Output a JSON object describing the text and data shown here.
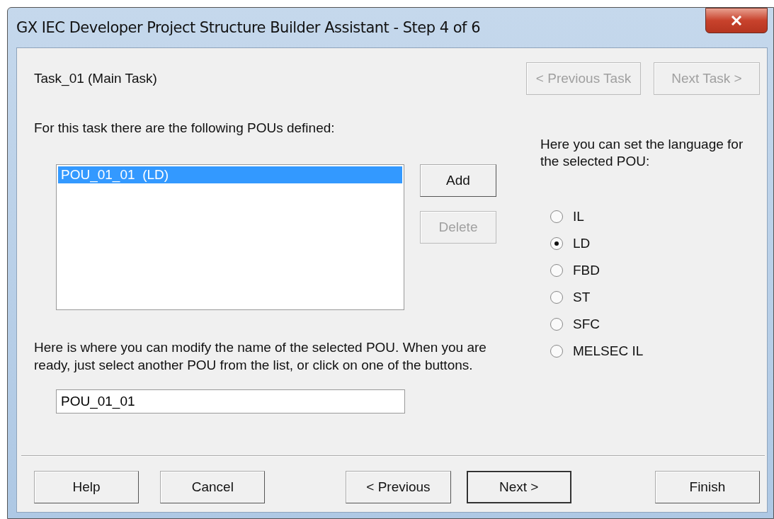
{
  "window": {
    "title": "GX IEC Developer Project Structure Builder Assistant - Step 4 of 6"
  },
  "task_label": "Task_01 (Main Task)",
  "task_nav": [
    {
      "label": "< Previous Task",
      "disabled": true
    },
    {
      "label": "Next Task >",
      "disabled": true
    }
  ],
  "pou_list": {
    "caption": "For this task there are the following POUs defined:",
    "items": [
      {
        "label": "POU_01_01  (LD)",
        "selected": true
      }
    ]
  },
  "pou_buttons": [
    {
      "label": "Add",
      "disabled": false
    },
    {
      "label": "Delete",
      "disabled": true
    }
  ],
  "language": {
    "caption": "Here you can set the language for the selected POU:",
    "options": [
      {
        "label": "IL",
        "selected": false
      },
      {
        "label": "LD",
        "selected": true
      },
      {
        "label": "FBD",
        "selected": false
      },
      {
        "label": "ST",
        "selected": false
      },
      {
        "label": "SFC",
        "selected": false
      },
      {
        "label": "MELSEC IL",
        "selected": false
      }
    ]
  },
  "rename": {
    "caption": "Here is where you can modify the name of the selected POU. When you are ready, just select another POU from the list, or click on one of the buttons.",
    "value": "POU_01_01"
  },
  "buttons": [
    {
      "label": "Help",
      "default": false
    },
    {
      "label": "Cancel",
      "default": false
    },
    {
      "label": "< Previous",
      "default": false
    },
    {
      "label": "Next >",
      "default": true
    },
    {
      "label": "Finish",
      "default": false
    }
  ]
}
